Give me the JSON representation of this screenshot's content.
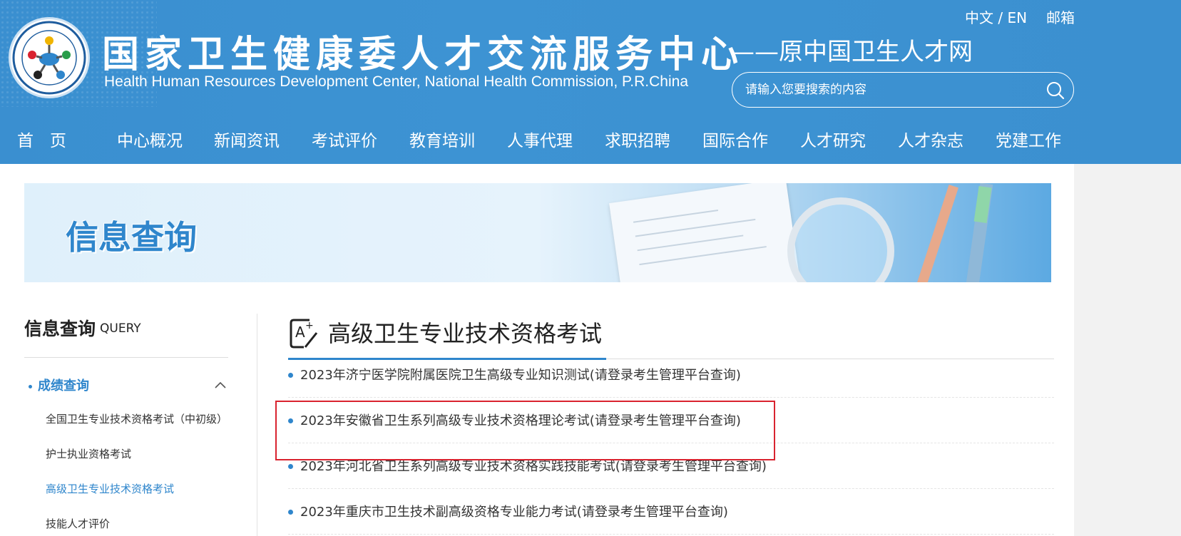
{
  "header": {
    "title_cn": "国家卫生健康委人才交流服务中心",
    "title_en": "Health Human Resources Development Center, National Health Commission, P.R.China",
    "slogan": "——原中国卫生人才网",
    "lang": "中文 / EN",
    "mail": "邮箱",
    "search_placeholder": "请输入您要搜索的内容"
  },
  "nav": {
    "items": [
      "首　页",
      "中心概况",
      "新闻资讯",
      "考试评价",
      "教育培训",
      "人事代理",
      "求职招聘",
      "国际合作",
      "人才研究",
      "人才杂志",
      "党建工作"
    ]
  },
  "banner": {
    "title": "信息查询"
  },
  "sidebar": {
    "title": "信息查询",
    "title_en": "QUERY",
    "active_group": "成绩查询",
    "sub_items": [
      "全国卫生专业技术资格考试（中初级）",
      "护士执业资格考试",
      "高级卫生专业技术资格考试",
      "技能人才评价"
    ]
  },
  "content": {
    "title": "高级卫生专业技术资格考试",
    "rows": [
      "2023年济宁医学院附属医院卫生高级专业知识测试(请登录考生管理平台查询)",
      "2023年安徽省卫生系列高级专业技术资格理论考试(请登录考生管理平台查询)",
      "2023年河北省卫生系列高级专业技术资格实践技能考试(请登录考生管理平台查询)",
      "2023年重庆市卫生技术副高级资格专业能力考试(请登录考生管理平台查询)"
    ]
  },
  "colors": {
    "header_blue": "#3b90d0",
    "accent": "#2f86cc",
    "highlight_border": "#d9232f"
  }
}
